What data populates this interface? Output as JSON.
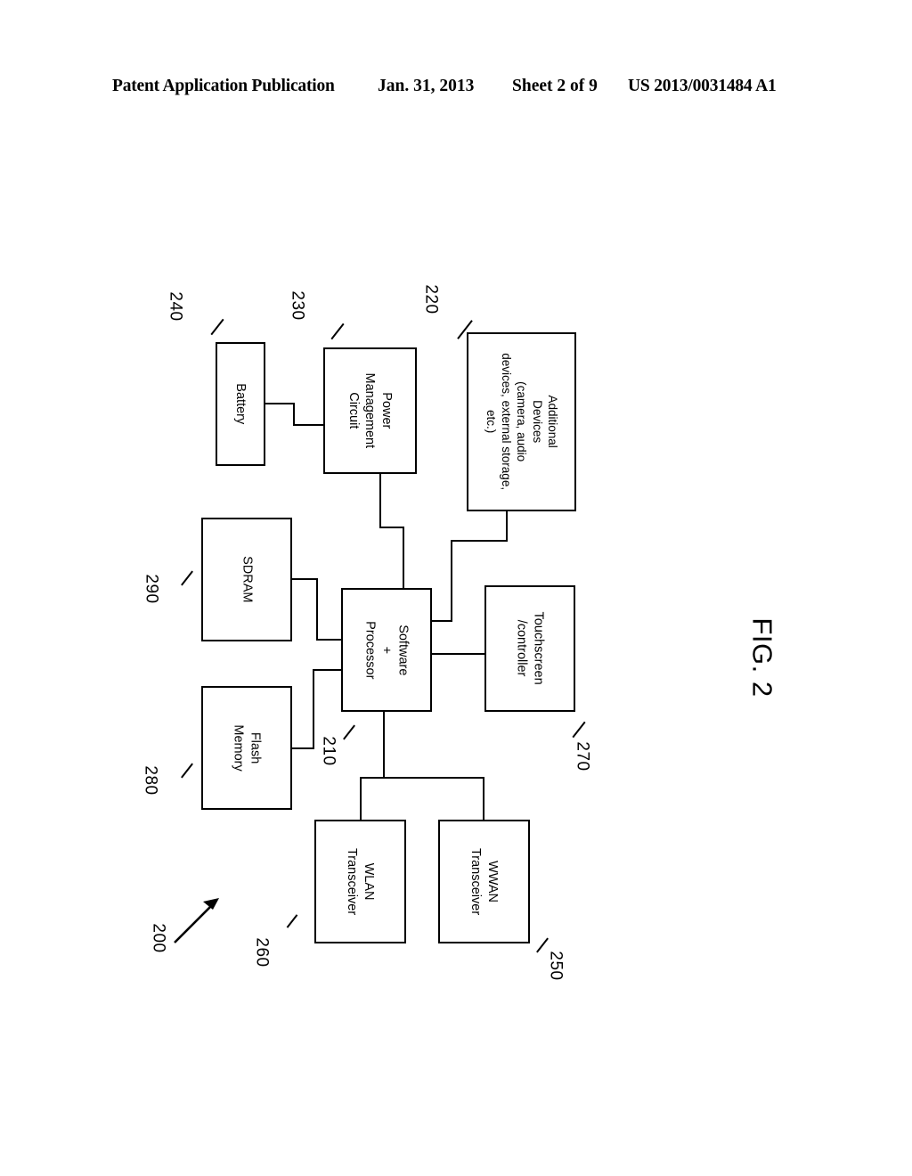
{
  "header": {
    "publication": "Patent Application Publication",
    "date": "Jan. 31, 2013",
    "sheet": "Sheet 2 of 9",
    "patent_number": "US 2013/0031484 A1"
  },
  "figure": {
    "caption": "FIG. 2",
    "system_reference": "200"
  },
  "blocks": [
    {
      "id": "battery",
      "label": "Battery",
      "ref": "240"
    },
    {
      "id": "power-management",
      "label": "Power\nManagement\nCircuit",
      "ref": "230"
    },
    {
      "id": "additional-devices",
      "label": "Additional\nDevices\n(camera, audio\ndevices, external storage,\netc.)",
      "ref": "220"
    },
    {
      "id": "sdram",
      "label": "SDRAM",
      "ref": "290"
    },
    {
      "id": "flash-memory",
      "label": "Flash\nMemory",
      "ref": "280"
    },
    {
      "id": "processor",
      "label": "Software\n+\nProcessor",
      "ref": "210"
    },
    {
      "id": "touchscreen",
      "label": "Touchscreen\n/controller",
      "ref": "270"
    },
    {
      "id": "wlan-transceiver",
      "label": "WLAN\nTransceiver",
      "ref": "260"
    },
    {
      "id": "wwan-transceiver",
      "label": "WWAN\nTransceiver",
      "ref": "250"
    }
  ],
  "colors": {
    "ink": "#000000",
    "paper": "#ffffff"
  }
}
